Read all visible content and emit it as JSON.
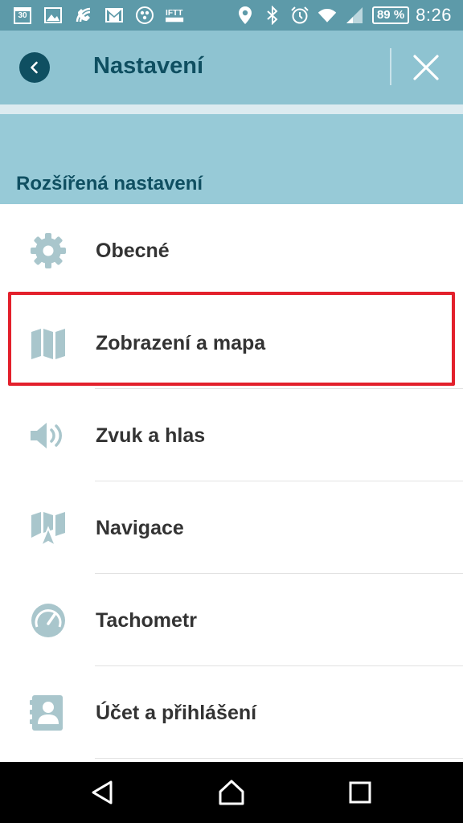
{
  "status_bar": {
    "calendar_day": "30",
    "left_icons": [
      "calendar-icon",
      "image-icon",
      "wifi-calling-icon",
      "gmail-icon",
      "app-icon",
      "ifttt-icon"
    ],
    "right_icons": [
      "location-icon",
      "bluetooth-icon",
      "alarm-icon",
      "wifi-icon",
      "signal-icon"
    ],
    "battery": "89 %",
    "time": "8:26"
  },
  "header": {
    "title": "Nastavení",
    "back_icon": "back-arrow-icon",
    "close_icon": "close-icon"
  },
  "section": {
    "title": "Rozšířená nastavení"
  },
  "menu": {
    "items": [
      {
        "label": "Obecné",
        "icon": "gear-icon"
      },
      {
        "label": "Zobrazení a mapa",
        "icon": "map-icon",
        "highlighted": true
      },
      {
        "label": "Zvuk a hlas",
        "icon": "speaker-icon"
      },
      {
        "label": "Navigace",
        "icon": "navigation-map-icon"
      },
      {
        "label": "Tachometr",
        "icon": "speedometer-icon"
      },
      {
        "label": "Účet a přihlášení",
        "icon": "account-card-icon"
      }
    ]
  },
  "colors": {
    "status_bar": "#5d9aa9",
    "app_bar": "#8ec3d1",
    "section": "#97cad7",
    "title_text": "#0f4f61",
    "icon": "#a9c6cc",
    "highlight_border": "#e3202c"
  },
  "nav_bar": {
    "buttons": [
      "back-triangle-icon",
      "home-icon",
      "recents-icon"
    ]
  }
}
